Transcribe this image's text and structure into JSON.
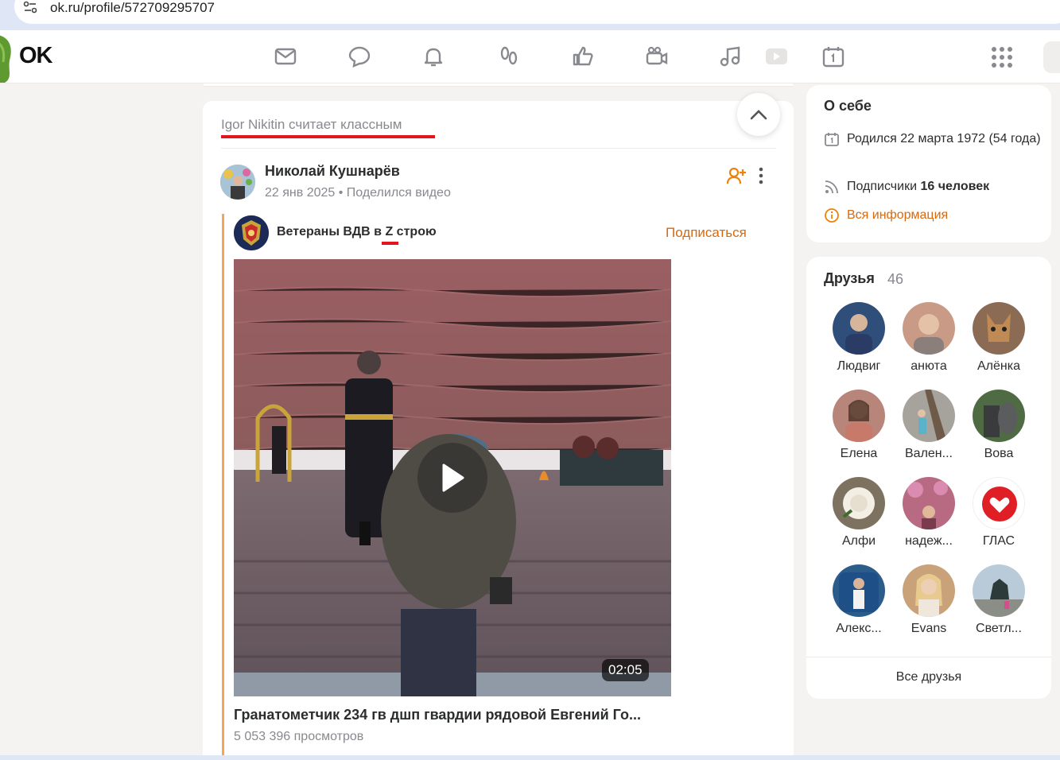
{
  "browser": {
    "url": "ok.ru/profile/572709295707"
  },
  "header": {
    "logo": "OK",
    "nav_icons": [
      "mail-icon",
      "chat-icon",
      "bell-icon",
      "footprints-icon",
      "like-icon",
      "video-camera-icon",
      "music-icon",
      "play-icon",
      "calendar-icon"
    ],
    "apps_icon": "apps-grid-icon"
  },
  "feed": {
    "liked_by": "Igor Nikitin считает классным",
    "post": {
      "author": "Николай Кушнарёв",
      "date": "22 янв 2025",
      "action": "Поделился видео",
      "separator": "•",
      "group": {
        "name_before": "Ветераны ВДВ в ",
        "name_z": "Z",
        "name_after": " строю",
        "subscribe_label": "Подписаться"
      },
      "video": {
        "duration": "02:05",
        "title": "Гранатометчик 234 гв дшп гвардии рядовой Евгений Го...",
        "views": "5 053 396 просмотров"
      }
    }
  },
  "about": {
    "title": "О себе",
    "born": "Родился 22 марта 1972 (54 года)",
    "subscribers_label": "Подписчики ",
    "subscribers_value": "16 человек",
    "all_info": "Вся информация"
  },
  "friends": {
    "title": "Друзья",
    "count": "46",
    "items": [
      {
        "name": "Людвиг",
        "color": "#2f4f7a"
      },
      {
        "name": "анюта",
        "color": "#c99a86"
      },
      {
        "name": "Алёнка",
        "color": "#8b6b53"
      },
      {
        "name": "Елена",
        "color": "#b8857a"
      },
      {
        "name": "Вален...",
        "color": "#a6a39c"
      },
      {
        "name": "Вова",
        "color": "#4f6b44"
      },
      {
        "name": "Алфи",
        "color": "#d6d2c4"
      },
      {
        "name": "надеж...",
        "color": "#b86a82"
      },
      {
        "name": "ГЛАС",
        "color": "#e01e26"
      },
      {
        "name": "Алекс...",
        "color": "#2c5c8a"
      },
      {
        "name": "Evans",
        "color": "#c9a27a"
      },
      {
        "name": "Светл...",
        "color": "#7c93a6"
      }
    ],
    "all_label": "Все друзья"
  }
}
